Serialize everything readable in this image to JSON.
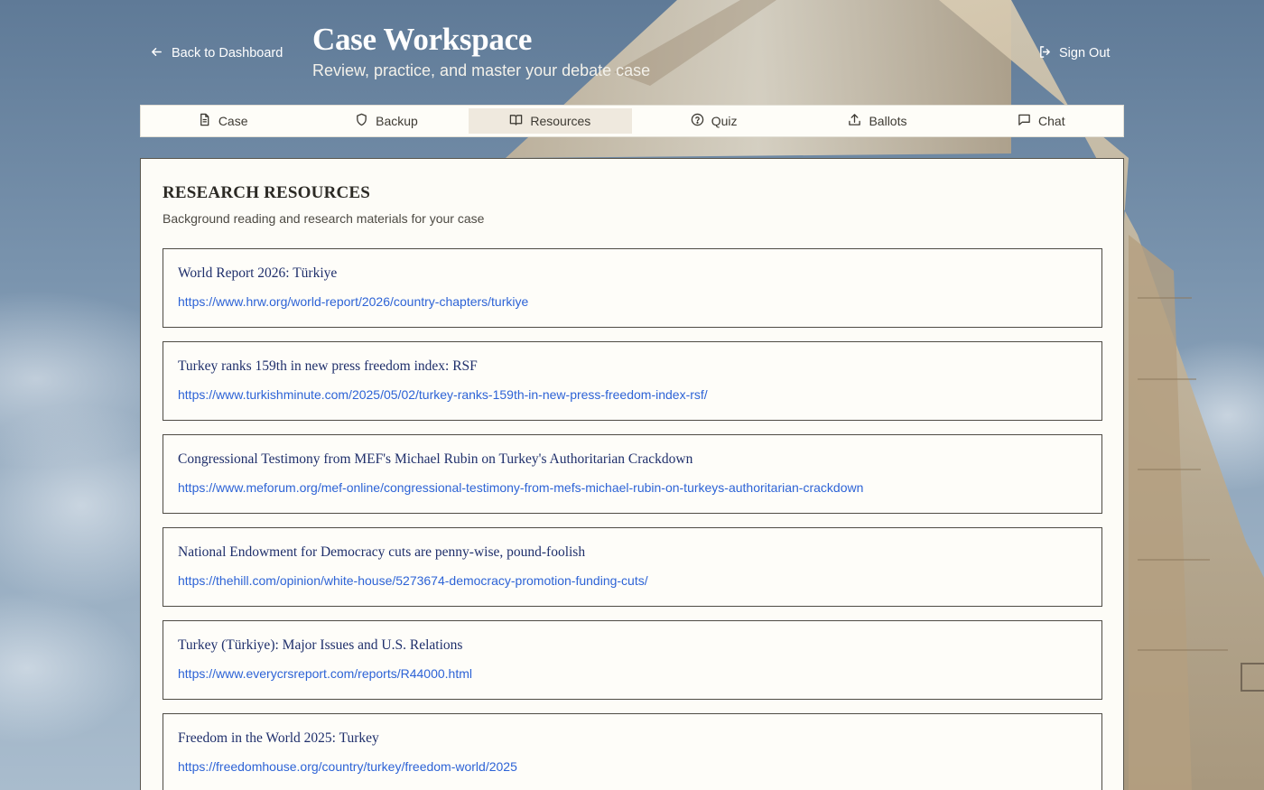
{
  "header": {
    "back_label": "Back to Dashboard",
    "title": "Case Workspace",
    "subtitle": "Review, practice, and master your debate case",
    "signout_label": "Sign Out"
  },
  "tabs": [
    {
      "label": "Case",
      "icon": "document-icon",
      "active": false
    },
    {
      "label": "Backup",
      "icon": "shield-icon",
      "active": false
    },
    {
      "label": "Resources",
      "icon": "book-open-icon",
      "active": true
    },
    {
      "label": "Quiz",
      "icon": "question-circle-icon",
      "active": false
    },
    {
      "label": "Ballots",
      "icon": "upload-icon",
      "active": false
    },
    {
      "label": "Chat",
      "icon": "chat-bubble-icon",
      "active": false
    }
  ],
  "resources": {
    "title": "RESEARCH RESOURCES",
    "description": "Background reading and research materials for your case",
    "items": [
      {
        "title": "World Report 2026: Türkiye",
        "url": "https://www.hrw.org/world-report/2026/country-chapters/turkiye"
      },
      {
        "title": "Turkey ranks 159th in new press freedom index: RSF",
        "url": "https://www.turkishminute.com/2025/05/02/turkey-ranks-159th-in-new-press-freedom-index-rsf/"
      },
      {
        "title": "Congressional Testimony from MEF's Michael Rubin on Turkey's Authoritarian Crackdown",
        "url": "https://www.meforum.org/mef-online/congressional-testimony-from-mefs-michael-rubin-on-turkeys-authoritarian-crackdown"
      },
      {
        "title": "National Endowment for Democracy cuts are penny-wise, pound-foolish",
        "url": "https://thehill.com/opinion/white-house/5273674-democracy-promotion-funding-cuts/"
      },
      {
        "title": "Turkey (Türkiye): Major Issues and U.S. Relations",
        "url": "https://www.everycrsreport.com/reports/R44000.html"
      },
      {
        "title": "Freedom in the World 2025: Turkey",
        "url": "https://freedomhouse.org/country/turkey/freedom-world/2025"
      }
    ]
  },
  "colors": {
    "accent_link": "#2d63d6",
    "title_link": "#1f2f6b",
    "active_tab": "#efe9de",
    "panel_bg": "#fdfcf7"
  }
}
